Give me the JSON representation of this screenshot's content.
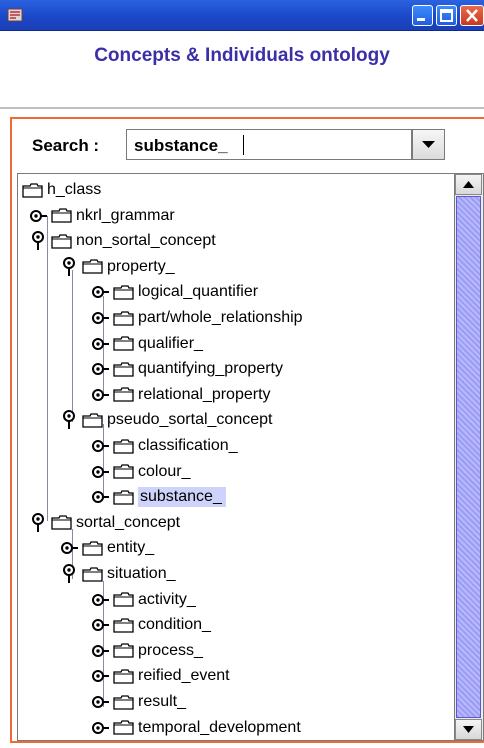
{
  "window": {
    "app_icon": "java-app-icon",
    "min_icon": "minimize-icon",
    "max_icon": "maximize-icon",
    "close_icon": "close-icon"
  },
  "header": {
    "title": "Concepts & Individuals ontology"
  },
  "search": {
    "label": "Search :",
    "value": "substance_",
    "dropdown_icon": "chevron-down-icon"
  },
  "tree": {
    "nodes": [
      {
        "label": "h_class",
        "level": 0,
        "toggle": "none"
      },
      {
        "label": "nkrl_grammar",
        "level": 1,
        "toggle": "collapsed"
      },
      {
        "label": "non_sortal_concept",
        "level": 1,
        "toggle": "expanded"
      },
      {
        "label": "property_",
        "level": 2,
        "toggle": "expanded"
      },
      {
        "label": "logical_quantifier",
        "level": 3,
        "toggle": "collapsed"
      },
      {
        "label": "part/whole_relationship",
        "level": 3,
        "toggle": "collapsed"
      },
      {
        "label": "qualifier_",
        "level": 3,
        "toggle": "collapsed"
      },
      {
        "label": "quantifying_property",
        "level": 3,
        "toggle": "collapsed"
      },
      {
        "label": "relational_property",
        "level": 3,
        "toggle": "collapsed"
      },
      {
        "label": "pseudo_sortal_concept",
        "level": 2,
        "toggle": "expanded"
      },
      {
        "label": "classification_",
        "level": 3,
        "toggle": "collapsed"
      },
      {
        "label": "colour_",
        "level": 3,
        "toggle": "collapsed"
      },
      {
        "label": "substance_",
        "level": 3,
        "toggle": "collapsed",
        "selected": true
      },
      {
        "label": "sortal_concept",
        "level": 1,
        "toggle": "expanded"
      },
      {
        "label": "entity_",
        "level": 2,
        "toggle": "collapsed"
      },
      {
        "label": "situation_",
        "level": 2,
        "toggle": "expanded"
      },
      {
        "label": "activity_",
        "level": 3,
        "toggle": "collapsed"
      },
      {
        "label": "condition_",
        "level": 3,
        "toggle": "collapsed"
      },
      {
        "label": "process_",
        "level": 3,
        "toggle": "collapsed"
      },
      {
        "label": "reified_event",
        "level": 3,
        "toggle": "collapsed"
      },
      {
        "label": "result_",
        "level": 3,
        "toggle": "collapsed"
      },
      {
        "label": "temporal_development",
        "level": 3,
        "toggle": "collapsed"
      }
    ]
  },
  "scroll": {
    "up_icon": "scroll-up-arrow-icon",
    "down_icon": "scroll-down-arrow-icon"
  },
  "colors": {
    "accent": "#f06a32",
    "title_text": "#3b2fa8",
    "selection": "#cdd3fb",
    "titlebar": "#1b48c8"
  }
}
